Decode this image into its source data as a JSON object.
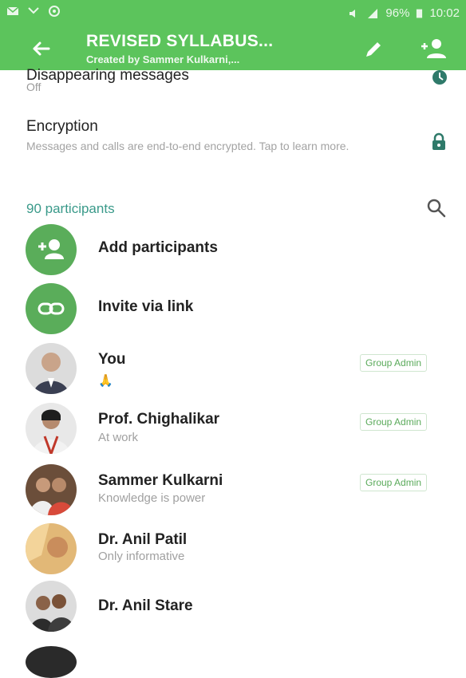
{
  "status_bar": {
    "battery": "96%",
    "time": "10:02"
  },
  "header": {
    "title": "REVISED SYLLABUS...",
    "subtitle": "Created by Sammer Kulkarni,..."
  },
  "settings": {
    "disappearing_title": "Disappearing messages",
    "disappearing_value": "Off",
    "encryption_title": "Encryption",
    "encryption_desc": "Messages and calls are end-to-end encrypted. Tap to learn more."
  },
  "participants": {
    "count_label": "90 participants",
    "add_label": "Add participants",
    "invite_label": "Invite via link",
    "members": [
      {
        "name": "You",
        "status": "🙏",
        "badge": "Group Admin"
      },
      {
        "name": "Prof. Chighalikar",
        "status": "At work",
        "badge": "Group Admin"
      },
      {
        "name": "Sammer Kulkarni",
        "status": "Knowledge is power",
        "badge": "Group Admin"
      },
      {
        "name": "Dr. Anil Patil",
        "status": "Only informative",
        "badge": ""
      },
      {
        "name": "Dr. Anil Stare",
        "status": "",
        "badge": ""
      }
    ]
  },
  "colors": {
    "accent": "#5cc45c",
    "action_circle": "#5aad5a",
    "section_header": "#3a9a8a"
  }
}
